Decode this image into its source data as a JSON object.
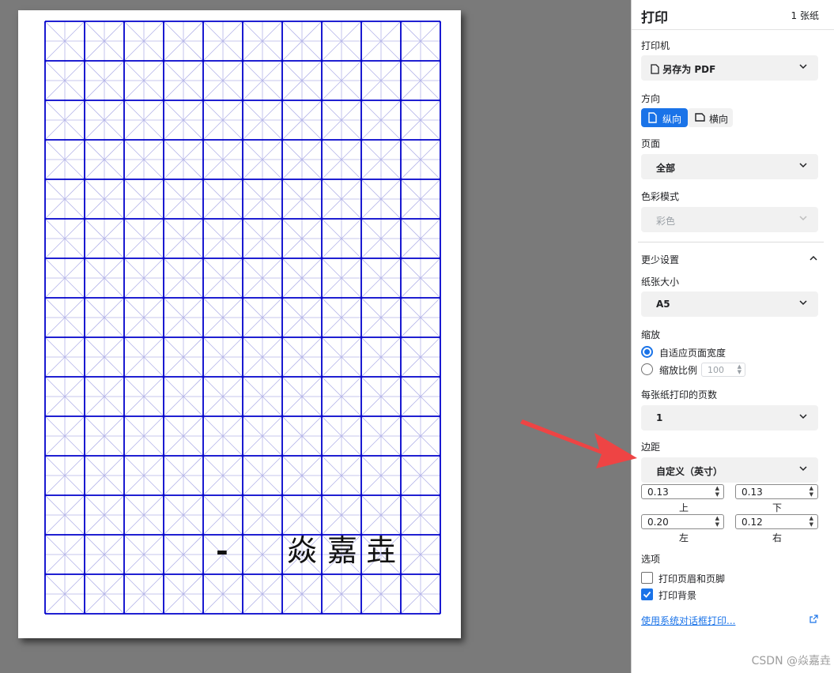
{
  "preview": {
    "grid": {
      "cols": 10,
      "rows": 15,
      "line_color": "#0000cc",
      "sub_line_color": "#b4b4e8"
    },
    "paper_text": {
      "dash": "-",
      "c1": "焱",
      "c2": "嘉",
      "c3": "垚"
    }
  },
  "sidebar": {
    "title": "打印",
    "sheets": "1 张纸",
    "printer": {
      "label": "打印机",
      "value": "另存为 PDF"
    },
    "orientation": {
      "label": "方向",
      "portrait": "纵向",
      "landscape": "横向",
      "selected": "portrait"
    },
    "pages": {
      "label": "页面",
      "value": "全部"
    },
    "color": {
      "label": "色彩模式",
      "value": "彩色"
    },
    "less_settings": "更少设置",
    "paper_size": {
      "label": "纸张大小",
      "value": "A5"
    },
    "scale": {
      "label": "缩放",
      "fit_width": "自适应页面宽度",
      "custom": "缩放比例",
      "custom_value": "100"
    },
    "pages_per_sheet": {
      "label": "每张纸打印的页数",
      "value": "1"
    },
    "margins": {
      "label": "边距",
      "value": "自定义（英寸）",
      "top": {
        "label": "上",
        "value": "0.13"
      },
      "bottom": {
        "label": "下",
        "value": "0.13"
      },
      "left": {
        "label": "左",
        "value": "0.20"
      },
      "right": {
        "label": "右",
        "value": "0.12"
      }
    },
    "options": {
      "label": "选项",
      "headers_footers": "打印页眉和页脚",
      "background": "打印背景"
    },
    "system_dialog": "使用系统对话框打印..."
  },
  "watermark": "CSDN @焱嘉垚",
  "colors": {
    "accent": "#1a73e8",
    "preview_bg": "#7a7a7a",
    "arrow": "#ee4444"
  }
}
